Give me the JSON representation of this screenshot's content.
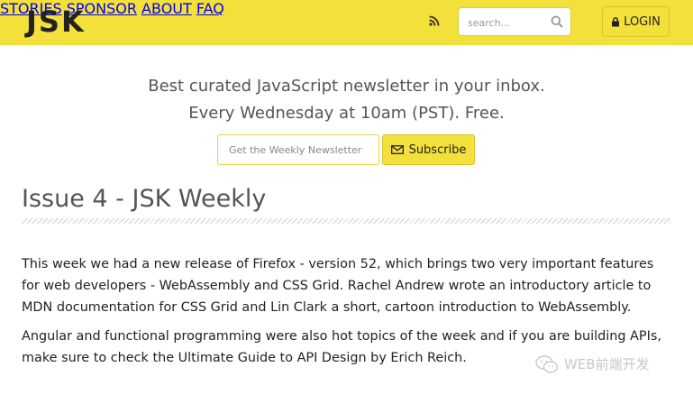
{
  "header": {
    "logo": "JSK",
    "nav": [
      "STORIES",
      "SPONSOR",
      "ABOUT",
      "FAQ"
    ],
    "search_placeholder": "search...",
    "login_label": "LOGIN",
    "accent_color": "#f4e03a"
  },
  "hero": {
    "line1": "Best curated JavaScript newsletter in your inbox.",
    "line2": "Every Wednesday at 10am (PST). Free.",
    "email_placeholder": "Get the Weekly Newsletter",
    "subscribe_label": "Subscribe"
  },
  "article": {
    "title": "Issue 4 - JSK Weekly",
    "paragraphs": [
      "This week we had a new release of Firefox - version 52, which brings two very important features for web developers - WebAssembly and CSS Grid. Rachel Andrew wrote an introductory article to MDN documentation for CSS Grid and Lin Clark a short, cartoon introduction to WebAssembly.",
      "Angular and functional programming were also hot topics of the week and if you are building APIs, make sure to check the Ultimate Guide to API Design by Erich Reich."
    ]
  },
  "watermark": {
    "text": "WEB前端开发",
    "icon": "wechat-icon"
  }
}
